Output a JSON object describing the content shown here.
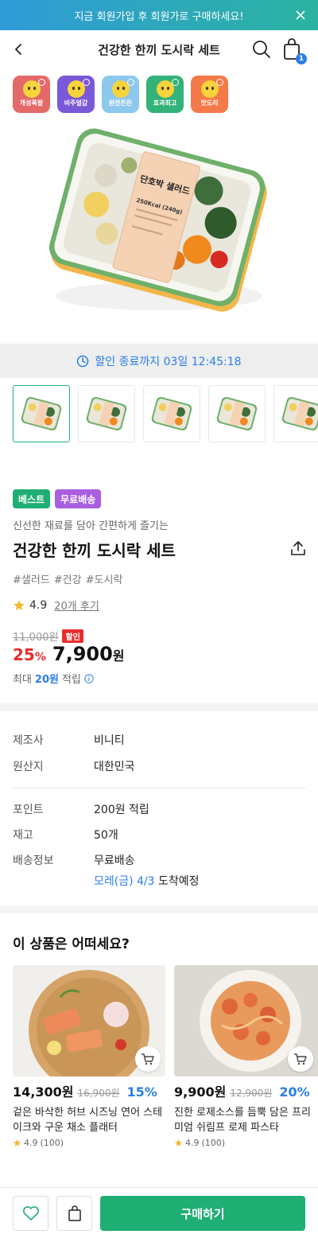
{
  "promo": {
    "text": "지금 회원가입 후 회원가로 구매하세요!"
  },
  "header": {
    "title": "건강한 한끼 도시락 세트",
    "cart_count": "1"
  },
  "badges": [
    {
      "label": "개성폭발",
      "color": "#e46a6a"
    },
    {
      "label": "비주얼갑",
      "color": "#7b58d8"
    },
    {
      "label": "완전든든",
      "color": "#8dc8ee"
    },
    {
      "label": "효과최고",
      "color": "#33b27a"
    },
    {
      "label": "맛도리",
      "color": "#f57a4a"
    }
  ],
  "hero": {
    "label_title": "단호박 샐러드",
    "label_kcal": "250Kcal (240g)"
  },
  "countdown": {
    "text": "할인 종료까지 03일 12:45:18"
  },
  "product": {
    "tags": [
      {
        "label": "베스트",
        "color": "#1fae74"
      },
      {
        "label": "무료배송",
        "color": "#a95ee0"
      }
    ],
    "subtitle": "신선한 재료를 담아 간편하게 즐기는",
    "title": "건강한 한끼 도시락 세트",
    "hashtags": [
      "#샐러드",
      "#건강",
      "#도시락"
    ],
    "rating": "4.9",
    "reviews": "20개 후기",
    "original_price": "11,000원",
    "sale_label": "할인",
    "discount": "25",
    "discount_unit": "%",
    "price": "7,900",
    "price_unit": "원",
    "points_prefix": "최대",
    "points_value": "20원",
    "points_suffix": "적립"
  },
  "specs": {
    "maker_key": "제조사",
    "maker": "비니티",
    "origin_key": "원산지",
    "origin": "대한민국",
    "point_key": "포인트",
    "point": "200원 적립",
    "stock_key": "재고",
    "stock": "50개",
    "ship_key": "배송정보",
    "ship": "무료배송",
    "ship_date": "모레(금) 4/3",
    "ship_date_suffix": "도착예정"
  },
  "recommend": {
    "title": "이 상품은 어떠세요?",
    "items": [
      {
        "price": "14,300원",
        "orig": "16,900원",
        "discount": "15%",
        "name": "겉은 바삭한 허브 시즈닝 연어 스테이크와 구운 채소 플래터",
        "rating": "4.9",
        "count": "(100)"
      },
      {
        "price": "9,900원",
        "orig": "12,900원",
        "discount": "20%",
        "name": "진한 로제소스를 듬뿍 담은 프리미엄 쉬림프 로제 파스타",
        "rating": "4.9",
        "count": "(100)"
      }
    ]
  },
  "bottom": {
    "buy_label": "구매하기"
  }
}
